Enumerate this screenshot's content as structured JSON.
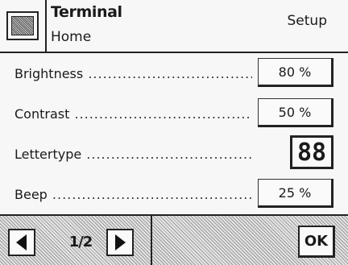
{
  "header": {
    "title": "Terminal",
    "subtitle": "Home",
    "mode": "Setup",
    "icon": "terminal-device-icon"
  },
  "settings": [
    {
      "label": "Brightness",
      "value": "80 %"
    },
    {
      "label": "Contrast",
      "value": "50 %"
    },
    {
      "label": "Lettertype",
      "value": "88"
    },
    {
      "label": "Beep",
      "value": "25 %"
    }
  ],
  "footer": {
    "page_indicator": "1/2",
    "prev_icon": "triangle-left-icon",
    "next_icon": "triangle-right-icon",
    "ok_label": "OK"
  }
}
